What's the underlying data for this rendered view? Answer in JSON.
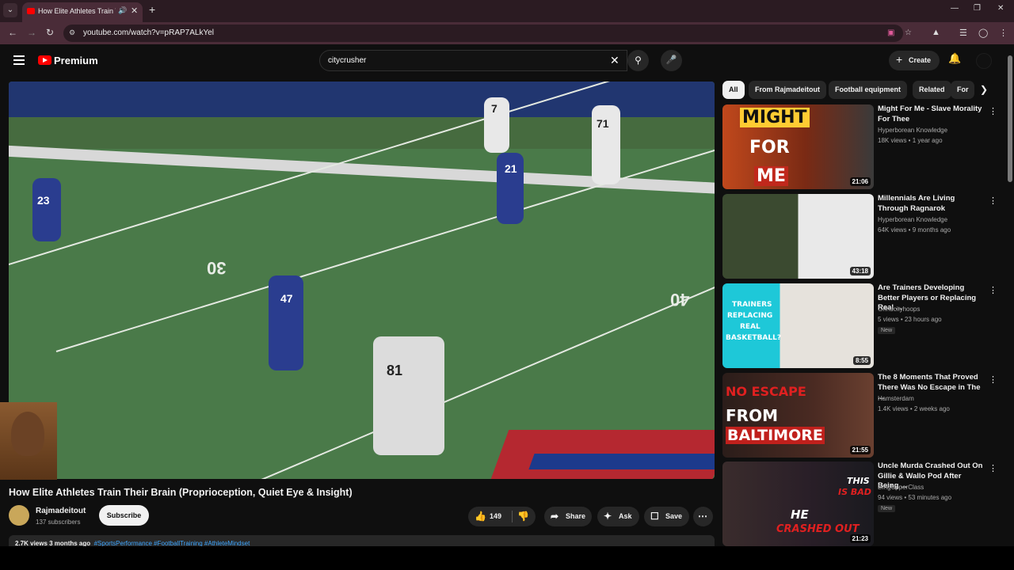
{
  "browser": {
    "tab_title": "How Elite Athletes Train Th",
    "url": "youtube.com/watch?v=pRAP7ALkYel"
  },
  "header": {
    "logo_text": "Premium",
    "search_value": "citycrusher",
    "create_label": "Create"
  },
  "video": {
    "title": "How Elite Athletes Train Their Brain (Proprioception, Quiet Eye & Insight)",
    "channel": "Rajmadeitout",
    "subscribers": "137 subscribers",
    "subscribe_label": "Subscribe",
    "likes": "149",
    "share_label": "Share",
    "ask_label": "Ask",
    "save_label": "Save",
    "views_date": "2.7K views  3 months ago",
    "hashtags": "#SportsPerformance #FootballTraining #AthleteMindset",
    "jersey_numbers": [
      "23",
      "21",
      "7",
      "71",
      "47",
      "81"
    ],
    "field_numbers": [
      "30",
      "40"
    ]
  },
  "chips": [
    "All",
    "From Rajmadeitout",
    "Football equipment",
    "Related",
    "For"
  ],
  "recommendations": [
    {
      "title": "Might For Me - Slave Morality For Thee",
      "channel": "Hyperborean Knowledge",
      "meta": "18K views • 1 year ago",
      "duration": "21:06",
      "thumb_text": [
        "MIGHT",
        "FOR",
        "ME"
      ],
      "new": ""
    },
    {
      "title": "Millennials Are Living Through Ragnarok",
      "channel": "Hyperborean Knowledge",
      "meta": "64K views • 9 months ago",
      "duration": "43:18",
      "thumb_text": [],
      "new": ""
    },
    {
      "title": "Are Trainers Developing Better Players or Replacing Real ...",
      "channel": "Grindcityhoops",
      "meta": "5 views • 23 hours ago",
      "duration": "8:55",
      "thumb_text": [
        "TRAINERS",
        "REPLACING",
        "REAL",
        "BASKETBALL?"
      ],
      "new": "New"
    },
    {
      "title": "The 8 Moments That Proved There Was No Escape in The ...",
      "channel": "Hamsterdam",
      "meta": "1.4K views • 2 weeks ago",
      "duration": "21:55",
      "thumb_text": [
        "NO ESCAPE",
        "FROM",
        "BALTIMORE"
      ],
      "new": ""
    },
    {
      "title": "Uncle Murda Crashed Out On Gillie & Wallo Pod After Being ...",
      "channel": "BmgUpperClass",
      "meta": "94 views • 53 minutes ago",
      "duration": "21:23",
      "thumb_text": [
        "THIS",
        "IS BAD",
        "HE",
        "CRASHED OUT"
      ],
      "new": "New"
    }
  ]
}
